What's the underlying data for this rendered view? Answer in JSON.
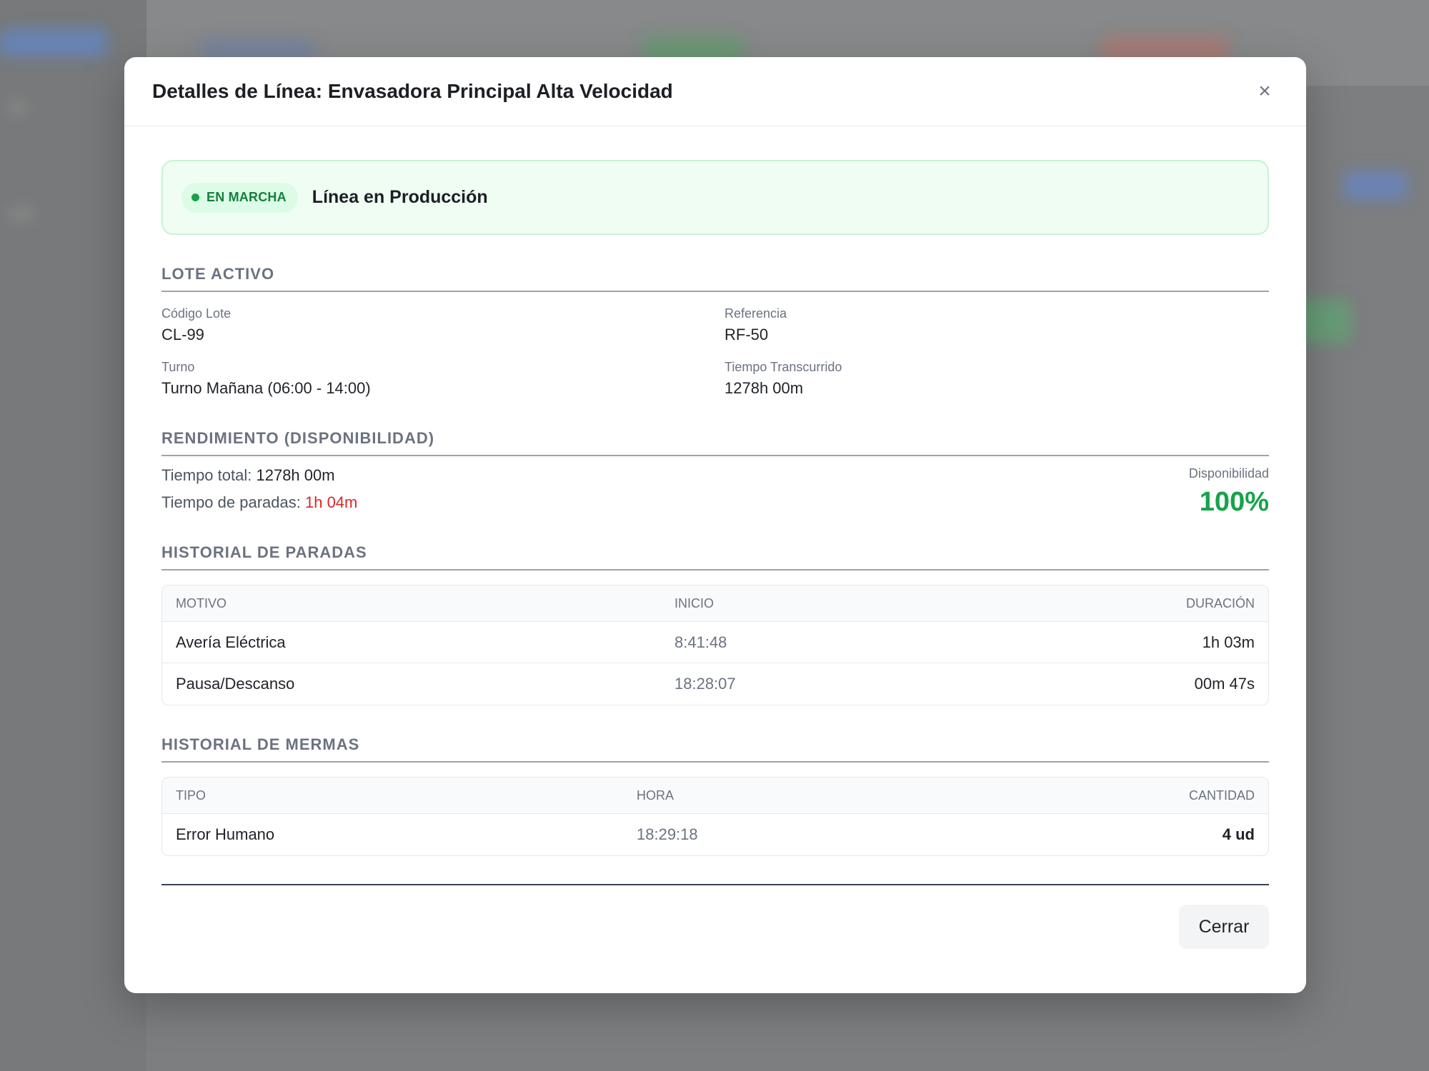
{
  "modal": {
    "title": "Detalles de Línea: Envasadora Principal Alta Velocidad",
    "close_icon": "×"
  },
  "status": {
    "badge": "EN MARCHA",
    "label": "Línea en Producción",
    "color": "#16a34a"
  },
  "lote": {
    "section_title": "LOTE ACTIVO",
    "fields": [
      {
        "label": "Código Lote",
        "value": "CL-99"
      },
      {
        "label": "Referencia",
        "value": "RF-50"
      },
      {
        "label": "Turno",
        "value": "Turno Mañana (06:00 - 14:00)"
      },
      {
        "label": "Tiempo Transcurrido",
        "value": "1278h 00m"
      }
    ]
  },
  "rendimiento": {
    "section_title": "RENDIMIENTO (DISPONIBILIDAD)",
    "total_label": "Tiempo total:",
    "total_value": "1278h 00m",
    "paradas_label": "Tiempo de paradas:",
    "paradas_value": "1h 04m",
    "availability_label": "Disponibilidad",
    "availability_value": "100%"
  },
  "paradas": {
    "section_title": "HISTORIAL DE PARADAS",
    "columns": [
      "MOTIVO",
      "INICIO",
      "DURACIÓN"
    ],
    "rows": [
      [
        "Avería Eléctrica",
        "8:41:48",
        "1h 03m"
      ],
      [
        "Pausa/Descanso",
        "18:28:07",
        "00m 47s"
      ]
    ]
  },
  "mermas": {
    "section_title": "HISTORIAL DE MERMAS",
    "columns": [
      "TIPO",
      "HORA",
      "CANTIDAD"
    ],
    "rows": [
      [
        "Error Humano",
        "18:29:18",
        "4 ud"
      ]
    ]
  },
  "footer": {
    "close_label": "Cerrar"
  }
}
